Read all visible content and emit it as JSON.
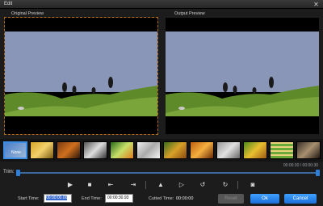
{
  "window": {
    "title": "Edit"
  },
  "previews": {
    "original_label": "Original Preview",
    "output_label": "Output Preview"
  },
  "effects": {
    "selected_label": "None"
  },
  "trim": {
    "label": "Trim:",
    "timecode": "00:00:30 / 00:00:30"
  },
  "times": {
    "start_label": "Start Time:",
    "start_value": "00:00:00.00",
    "end_label": "End Time:",
    "end_value": "00:00:30.93",
    "cutted_label": "Cutted Time:",
    "cutted_value": "00:00:00"
  },
  "buttons": {
    "reset": "Reset",
    "ok": "Ok",
    "cancel": "Cancel"
  },
  "icons": [
    "play-icon",
    "stop-icon",
    "set-start-icon",
    "set-end-icon",
    "warning-icon",
    "next-frame-icon",
    "rotate-left-icon",
    "rotate-right-icon",
    "snapshot-icon"
  ]
}
